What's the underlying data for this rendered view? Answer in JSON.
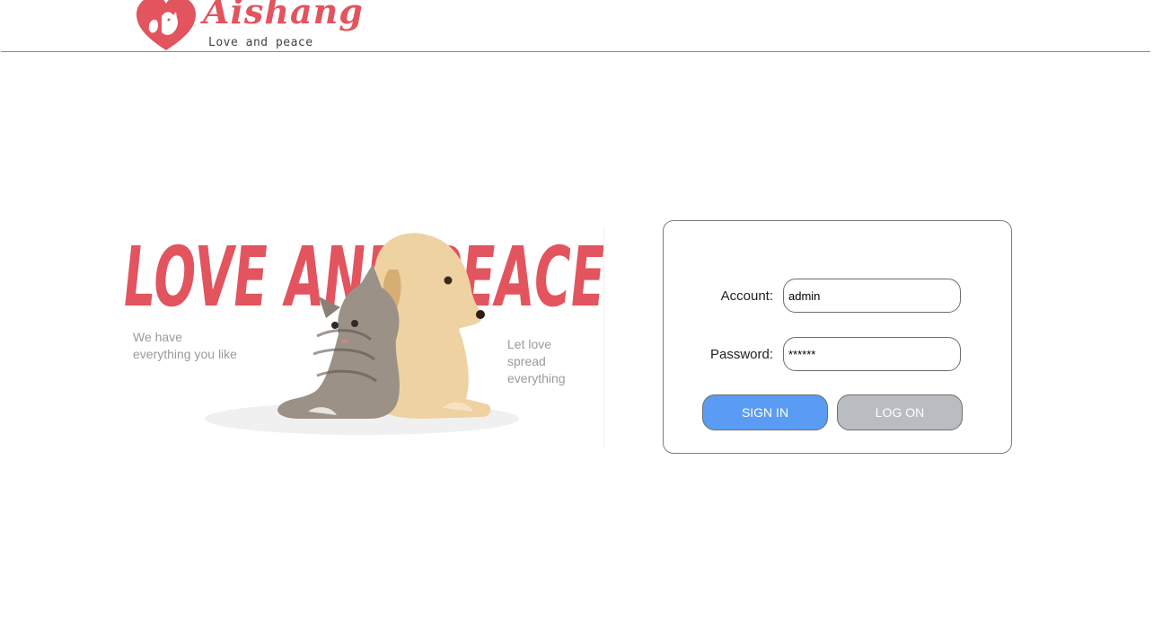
{
  "header": {
    "logo_name": "Aishang",
    "logo_tagline": "Love and peace",
    "brand_color": "#e2545e"
  },
  "banner": {
    "title": "LOVE AND PEACE",
    "left_text": [
      "We have",
      "everything you like"
    ],
    "right_text": [
      "Let love",
      "spread everything"
    ]
  },
  "login": {
    "account_label": "Account:",
    "account_value": "admin",
    "password_label": "Password:",
    "password_value": "******",
    "sign_in_label": "SIGN IN",
    "log_on_label": "LOG ON",
    "sign_in_color": "#5a9cf3",
    "log_on_color": "#b9bcc1"
  }
}
